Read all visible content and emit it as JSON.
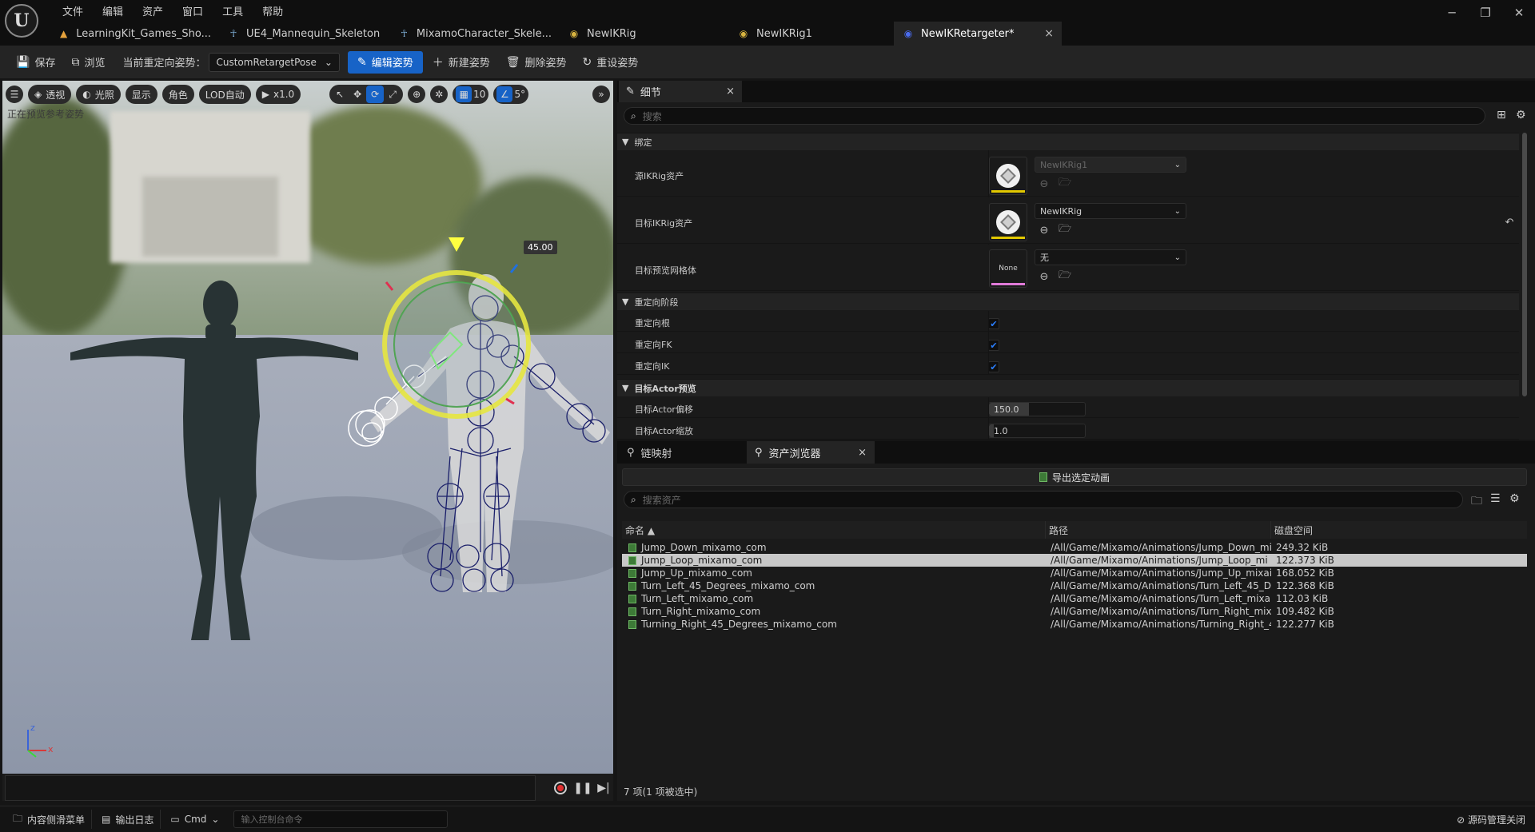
{
  "menu": [
    "文件",
    "编辑",
    "资产",
    "窗口",
    "工具",
    "帮助"
  ],
  "logo_text": "U",
  "window_controls": [
    "─",
    "❐",
    "✕"
  ],
  "tabs": [
    {
      "label": "LearningKit_Games_Sho...",
      "icon": "map-icon"
    },
    {
      "label": "UE4_Mannequin_Skeleton",
      "icon": "skeleton-icon"
    },
    {
      "label": "MixamoCharacter_Skele...",
      "icon": "skeleton-icon"
    },
    {
      "label": "NewIKRig",
      "icon": "ikrig-icon"
    },
    {
      "label": "NewIKRig1",
      "icon": "ikrig-icon"
    },
    {
      "label": "NewIKRetargeter*",
      "icon": "retargeter-icon",
      "close": "×"
    }
  ],
  "toolbar": {
    "save": "保存",
    "browse": "浏览",
    "current_pose_label": "当前重定向姿势：",
    "current_pose_value": "CustomRetargetPose",
    "edit_pose": "编辑姿势",
    "new_pose": "新建姿势",
    "delete_pose": "删除姿势",
    "reset_pose": "重设姿势"
  },
  "viewport": {
    "perspective": "透视",
    "lit": "光照",
    "show": "显示",
    "character": "角色",
    "lod": "LOD自动",
    "speed": "x1.0",
    "grid_size": "10",
    "angle_snap": "5°",
    "status_text": "正在预览参考姿势",
    "gizmo_value": "45.00",
    "axis_z": "z",
    "axis_x": "x"
  },
  "details": {
    "tab_label": "细节",
    "tab_close": "×",
    "search_placeholder": "搜索",
    "sections": {
      "binding": "绑定",
      "retarget_phase": "重定向阶段",
      "target_actor_preview": "目标Actor预览"
    },
    "source_ikrig_label": "源IKRig资产",
    "source_ikrig_value": "NewIKRig1",
    "target_ikrig_label": "目标IKRig资产",
    "target_ikrig_value": "NewIKRig",
    "target_mesh_label": "目标预览网格体",
    "target_mesh_value": "无",
    "target_mesh_thumb": "None",
    "retarget_root_label": "重定向根",
    "retarget_root_checked": true,
    "retarget_fk_label": "重定向FK",
    "retarget_fk_checked": true,
    "retarget_ik_label": "重定向IK",
    "retarget_ik_checked": true,
    "actor_offset_label": "目标Actor偏移",
    "actor_offset_value": "150.0",
    "actor_scale_label": "目标Actor缩放",
    "actor_scale_value": "1.0"
  },
  "bottom": {
    "chain_tab": "链映射",
    "asset_tab": "资产浏览器",
    "asset_tab_close": "×",
    "export_button": "导出选定动画",
    "search_placeholder": "搜索资产",
    "columns": [
      "命名 ▲",
      "路径",
      "磁盘空间"
    ],
    "rows": [
      {
        "name": "Jump_Down_mixamo_com",
        "path": "/All/Game/Mixamo/Animations/Jump_Down_mi",
        "size": "249.32 KiB",
        "selected": false
      },
      {
        "name": "Jump_Loop_mixamo_com",
        "path": "/All/Game/Mixamo/Animations/Jump_Loop_mi",
        "size": "122.373 KiB",
        "selected": true
      },
      {
        "name": "Jump_Up_mixamo_com",
        "path": "/All/Game/Mixamo/Animations/Jump_Up_mixai",
        "size": "168.052 KiB",
        "selected": false
      },
      {
        "name": "Turn_Left_45_Degrees_mixamo_com",
        "path": "/All/Game/Mixamo/Animations/Turn_Left_45_D",
        "size": "122.368 KiB",
        "selected": false
      },
      {
        "name": "Turn_Left_mixamo_com",
        "path": "/All/Game/Mixamo/Animations/Turn_Left_mixa",
        "size": "112.03 KiB",
        "selected": false
      },
      {
        "name": "Turn_Right_mixamo_com",
        "path": "/All/Game/Mixamo/Animations/Turn_Right_mix",
        "size": "109.482 KiB",
        "selected": false
      },
      {
        "name": "Turning_Right_45_Degrees_mixamo_com",
        "path": "/All/Game/Mixamo/Animations/Turning_Right_4",
        "size": "122.277 KiB",
        "selected": false
      }
    ],
    "count_text": "7 项(1 项被选中)"
  },
  "statusbar": {
    "content_drawer": "内容侧滑菜单",
    "output_log": "输出日志",
    "cmd": "Cmd",
    "console_placeholder": "输入控制台命令",
    "source_control": "源码管理关闭"
  },
  "colors": {
    "accent": "#1763c7",
    "source_underline": "#e2c800",
    "target_underline": "#e2c800",
    "mesh_underline": "#e07ad8"
  }
}
